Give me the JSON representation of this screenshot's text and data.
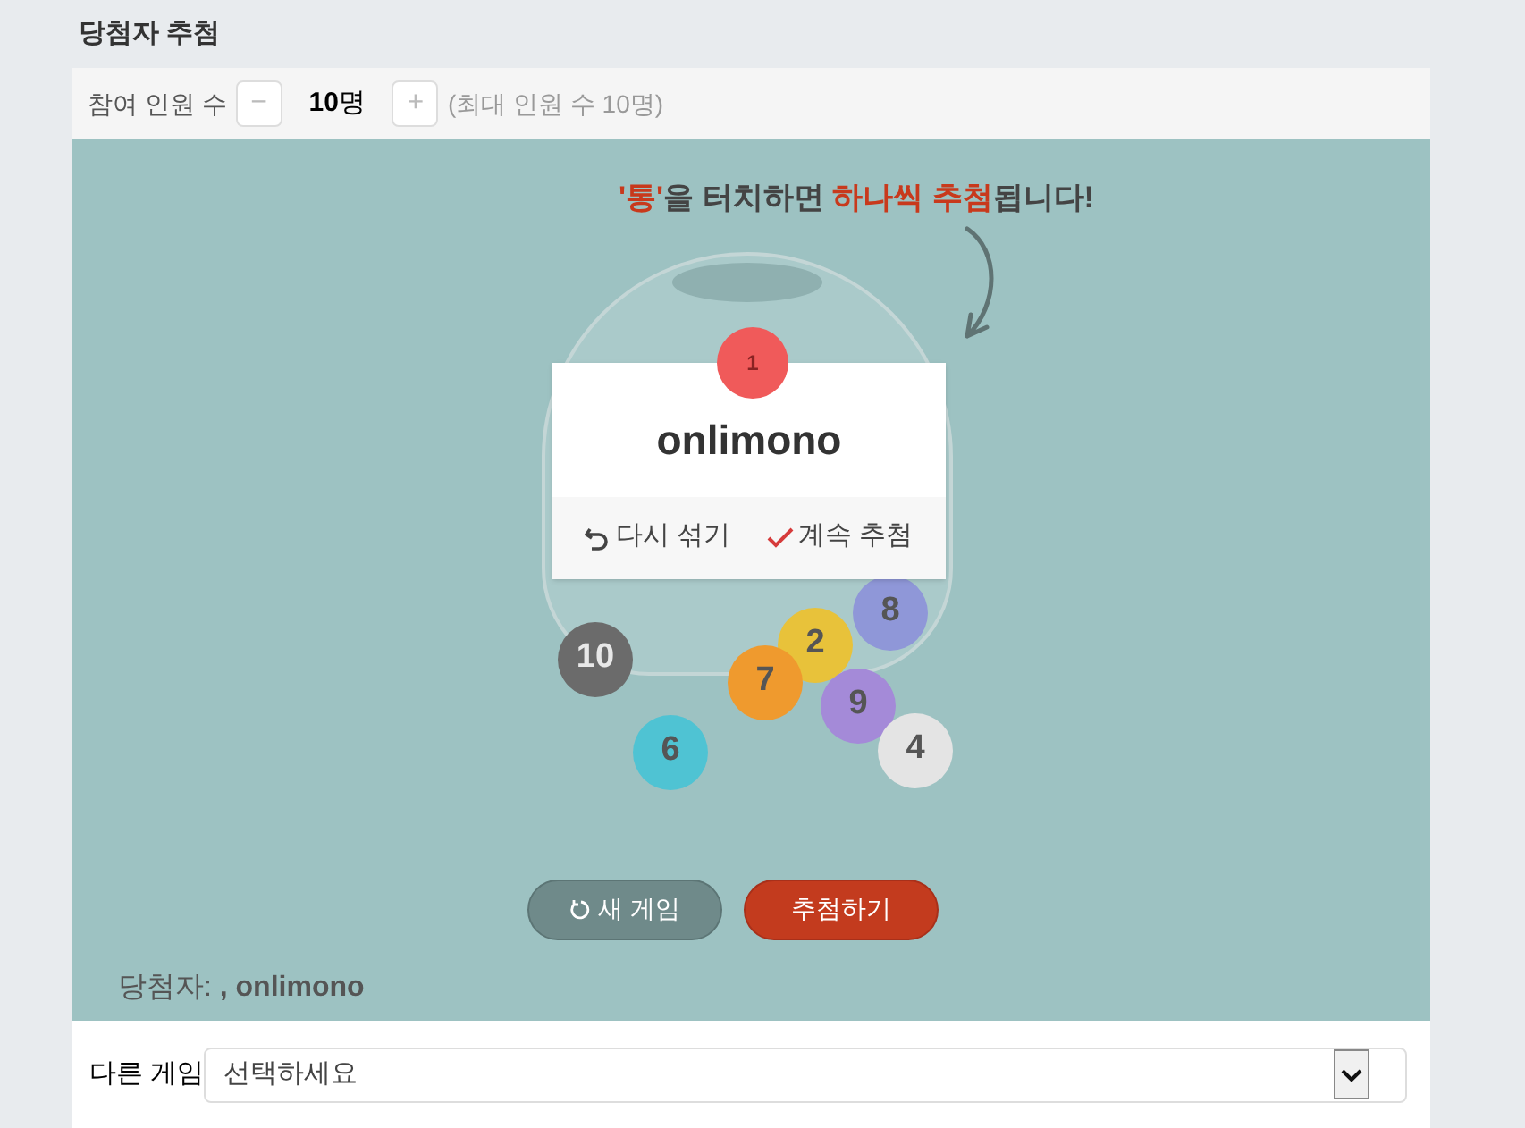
{
  "title": "당첨자 추첨",
  "participants": {
    "label": "참여 인원 수",
    "minus": "−",
    "value": "10",
    "unit": "명",
    "plus": "+",
    "note": "(최대 인원 수 10명)"
  },
  "hint": [
    {
      "text": "'통'",
      "highlight": true
    },
    {
      "text": "을 터치하면 ",
      "highlight": false
    },
    {
      "text": "하나씩 추첨",
      "highlight": true
    },
    {
      "text": "됩니다!",
      "highlight": false
    }
  ],
  "result_card": {
    "ball": "1",
    "name": "onlimono",
    "actions": [
      "다시 섞기",
      "계속 추첨"
    ]
  },
  "balls": [
    {
      "number": "10",
      "color": "#6b6b6b"
    },
    {
      "number": "2",
      "color": "#e8c23a"
    },
    {
      "number": "8",
      "color": "#8f97d8"
    },
    {
      "number": "7",
      "color": "#ef9a2e"
    },
    {
      "number": "9",
      "color": "#a48ad8"
    },
    {
      "number": "6",
      "color": "#4fc3d3"
    },
    {
      "number": "4",
      "color": "#e4e4e4"
    }
  ],
  "buttons": {
    "new_game": "새 게임",
    "draw": "추첨하기"
  },
  "winners": "당첨자: **, onlimono**",
  "other_game": {
    "label": "다른 게임",
    "value": "선택하세요"
  }
}
